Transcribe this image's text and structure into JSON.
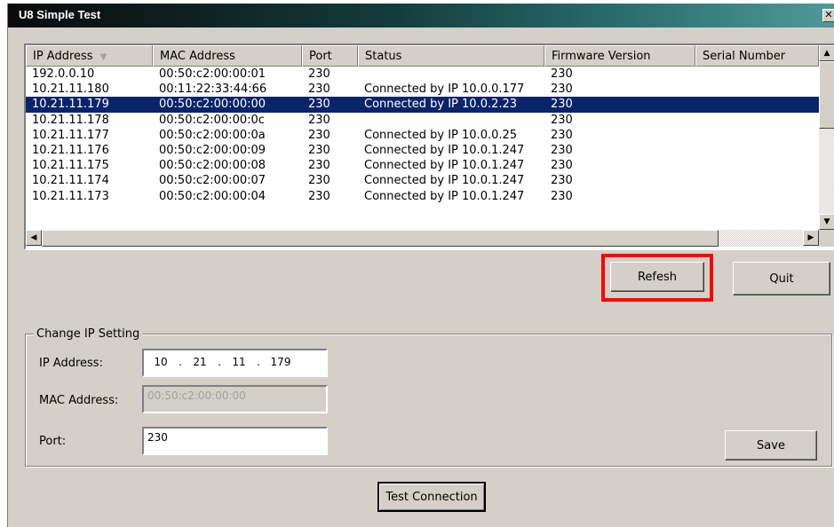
{
  "window": {
    "title": "U8 Simple Test",
    "close_glyph": "✕"
  },
  "table": {
    "columns": [
      "IP Address",
      "MAC Address",
      "Port",
      "Status",
      "Firmware Version",
      "Serial Number"
    ],
    "sort_indicator": "▼",
    "selected_row": 2,
    "rows": [
      [
        "192.0.0.10",
        "00:50:c2:00:00:01",
        "230",
        "",
        "230",
        ""
      ],
      [
        "10.21.11.180",
        "00:11:22:33:44:66",
        "230",
        "Connected by IP 10.0.0.177",
        "230",
        ""
      ],
      [
        "10.21.11.179",
        "00:50:c2:00:00:00",
        "230",
        "Connected by IP 10.0.2.23",
        "230",
        ""
      ],
      [
        "10.21.11.178",
        "00:50:c2:00:00:0c",
        "230",
        "",
        "230",
        ""
      ],
      [
        "10.21.11.177",
        "00:50:c2:00:00:0a",
        "230",
        "Connected by IP 10.0.0.25",
        "230",
        ""
      ],
      [
        "10.21.11.176",
        "00:50:c2:00:00:09",
        "230",
        "Connected by IP 10.0.1.247",
        "230",
        ""
      ],
      [
        "10.21.11.175",
        "00:50:c2:00:00:08",
        "230",
        "Connected by IP 10.0.1.247",
        "230",
        ""
      ],
      [
        "10.21.11.174",
        "00:50:c2:00:00:07",
        "230",
        "Connected by IP 10.0.1.247",
        "230",
        ""
      ],
      [
        "10.21.11.173",
        "00:50:c2:00:00:04",
        "230",
        "Connected by IP 10.0.1.247",
        "230",
        ""
      ]
    ]
  },
  "buttons": {
    "refresh": "Refesh",
    "quit": "Quit",
    "save": "Save",
    "test_connection": "Test Connection"
  },
  "colors": {
    "highlight": "#ff0000",
    "selection": "#0a246a"
  },
  "change_ip": {
    "group_title": "Change IP Setting",
    "ip_label": "IP Address:",
    "ip_octets": [
      "10",
      "21",
      "11",
      "179"
    ],
    "ip_separator": ".",
    "mac_label": "MAC Address:",
    "mac_value": "00:50:c2:00:00:00",
    "port_label": "Port:",
    "port_value": "230"
  }
}
